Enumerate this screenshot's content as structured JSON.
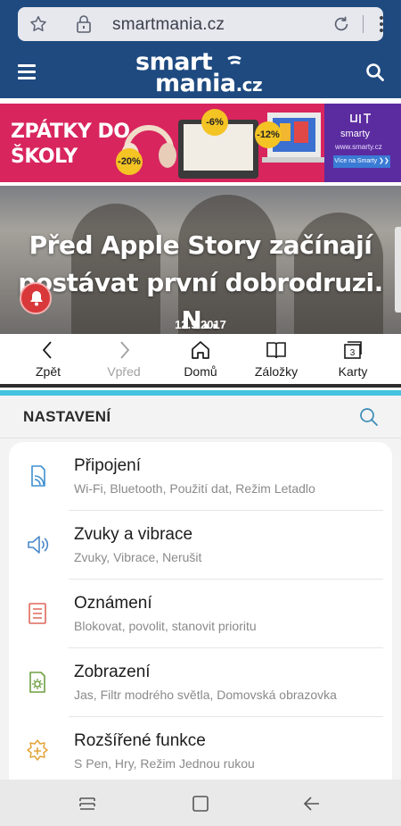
{
  "browser": {
    "url": "smartmania.cz",
    "logo": {
      "line1": "smart",
      "line2": "mania",
      "tld": ".cz"
    }
  },
  "banner": {
    "headline_line1": "ZPÁTKY DO",
    "headline_line2": "ŠKOLY",
    "discounts": [
      "-20%",
      "-6%",
      "-12%"
    ],
    "brand": "smarty",
    "brand_url": "www.smarty.cz",
    "cta": "Více na Smarty ❯❯"
  },
  "article": {
    "title_line1": "Před Apple Story začínají",
    "title_line2": "postávat první dobrodruzi. N..",
    "date": "12.9.2017"
  },
  "toolbar": {
    "items": [
      {
        "label": "Zpět",
        "icon": "back-chevron-icon",
        "enabled": true
      },
      {
        "label": "Vpřed",
        "icon": "forward-chevron-icon",
        "enabled": false
      },
      {
        "label": "Domů",
        "icon": "home-icon",
        "enabled": true
      },
      {
        "label": "Záložky",
        "icon": "bookmarks-icon",
        "enabled": true
      },
      {
        "label": "Karty",
        "icon": "tabs-icon",
        "enabled": true,
        "count": "3"
      }
    ]
  },
  "settings": {
    "title": "NASTAVENÍ",
    "items": [
      {
        "name": "Připojení",
        "sub": "Wi-Fi, Bluetooth, Použití dat, Režim Letadlo",
        "icon": "connections-icon",
        "color": "#3f8fd0"
      },
      {
        "name": "Zvuky a vibrace",
        "sub": "Zvuky, Vibrace, Nerušit",
        "icon": "sound-icon",
        "color": "#4a88c8"
      },
      {
        "name": "Oznámení",
        "sub": "Blokovat, povolit, stanovit prioritu",
        "icon": "notifications-icon",
        "color": "#e0685c"
      },
      {
        "name": "Zobrazení",
        "sub": "Jas, Filtr modrého světla, Domovská obrazovka",
        "icon": "display-icon",
        "color": "#6ea042"
      },
      {
        "name": "Rozšířené funkce",
        "sub": "S Pen, Hry, Režim Jednou rukou",
        "icon": "advanced-features-icon",
        "color": "#e3a33a"
      }
    ]
  },
  "colors": {
    "site_header": "#1e4a80",
    "banner_bg": "#d8255e",
    "split_accent": "#45c2e0",
    "bell": "#d9383a"
  }
}
